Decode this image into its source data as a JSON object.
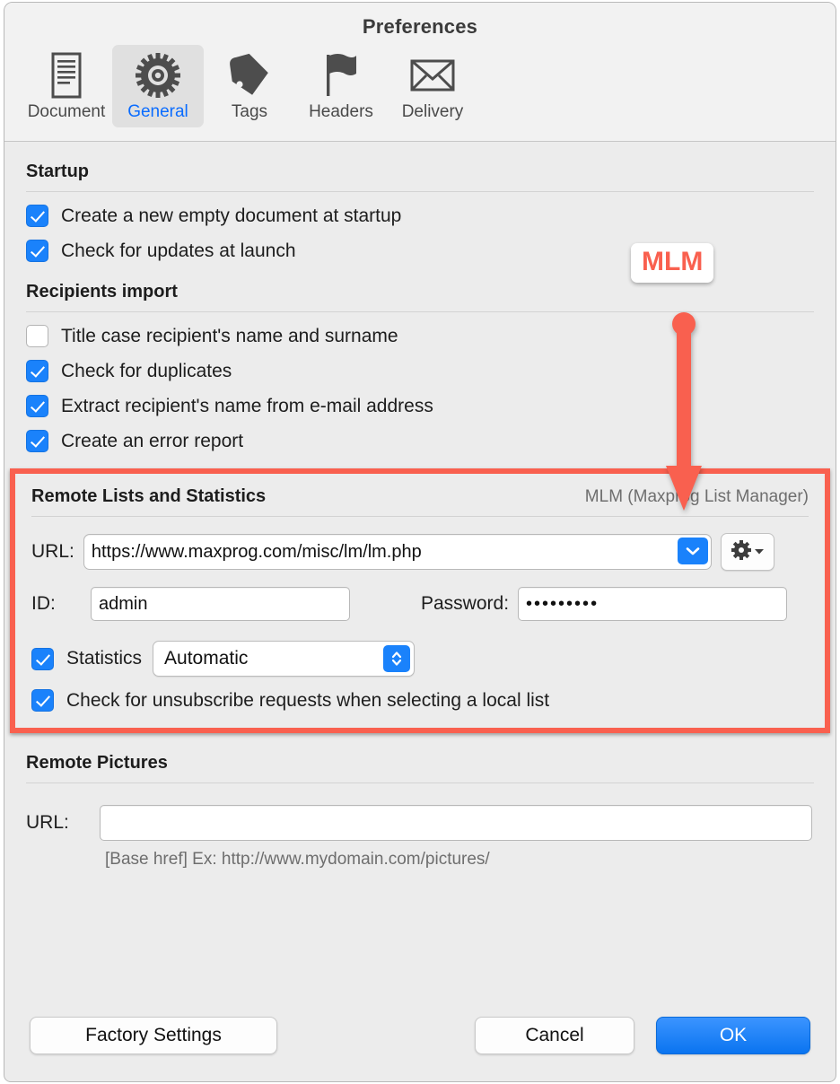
{
  "window": {
    "title": "Preferences"
  },
  "toolbar": {
    "items": [
      {
        "label": "Document",
        "icon": "document-icon",
        "selected": false
      },
      {
        "label": "General",
        "icon": "gear-icon",
        "selected": true
      },
      {
        "label": "Tags",
        "icon": "tag-icon",
        "selected": false
      },
      {
        "label": "Headers",
        "icon": "flag-icon",
        "selected": false
      },
      {
        "label": "Delivery",
        "icon": "envelope-icon",
        "selected": false
      }
    ]
  },
  "startup": {
    "title": "Startup",
    "options": [
      {
        "label": "Create a new empty document at startup",
        "checked": true
      },
      {
        "label": "Check for updates at launch",
        "checked": true
      }
    ]
  },
  "recipients_import": {
    "title": "Recipients import",
    "options": [
      {
        "label": "Title case recipient's name and surname",
        "checked": false
      },
      {
        "label": "Check for duplicates",
        "checked": true
      },
      {
        "label": "Extract recipient's name from e-mail address",
        "checked": true
      },
      {
        "label": "Create an error report",
        "checked": true
      }
    ]
  },
  "remote_lists": {
    "title": "Remote Lists and Statistics",
    "subtitle": "MLM (Maxprog List Manager)",
    "url_label": "URL:",
    "url_value": "https://www.maxprog.com/misc/lm/lm.php",
    "id_label": "ID:",
    "id_value": "admin",
    "password_label": "Password:",
    "password_value": "•••••••••",
    "statistics_label": "Statistics",
    "statistics_checked": true,
    "statistics_value": "Automatic",
    "unsubscribe_label": "Check for unsubscribe requests when selecting a local list",
    "unsubscribe_checked": true
  },
  "remote_pictures": {
    "title": "Remote Pictures",
    "url_label": "URL:",
    "url_value": "",
    "hint": "[Base href] Ex: http://www.mydomain.com/pictures/"
  },
  "annotation": {
    "badge_text": "MLM",
    "accent_color": "#f9604f"
  },
  "footer": {
    "factory_settings": "Factory Settings",
    "cancel": "Cancel",
    "ok": "OK"
  }
}
